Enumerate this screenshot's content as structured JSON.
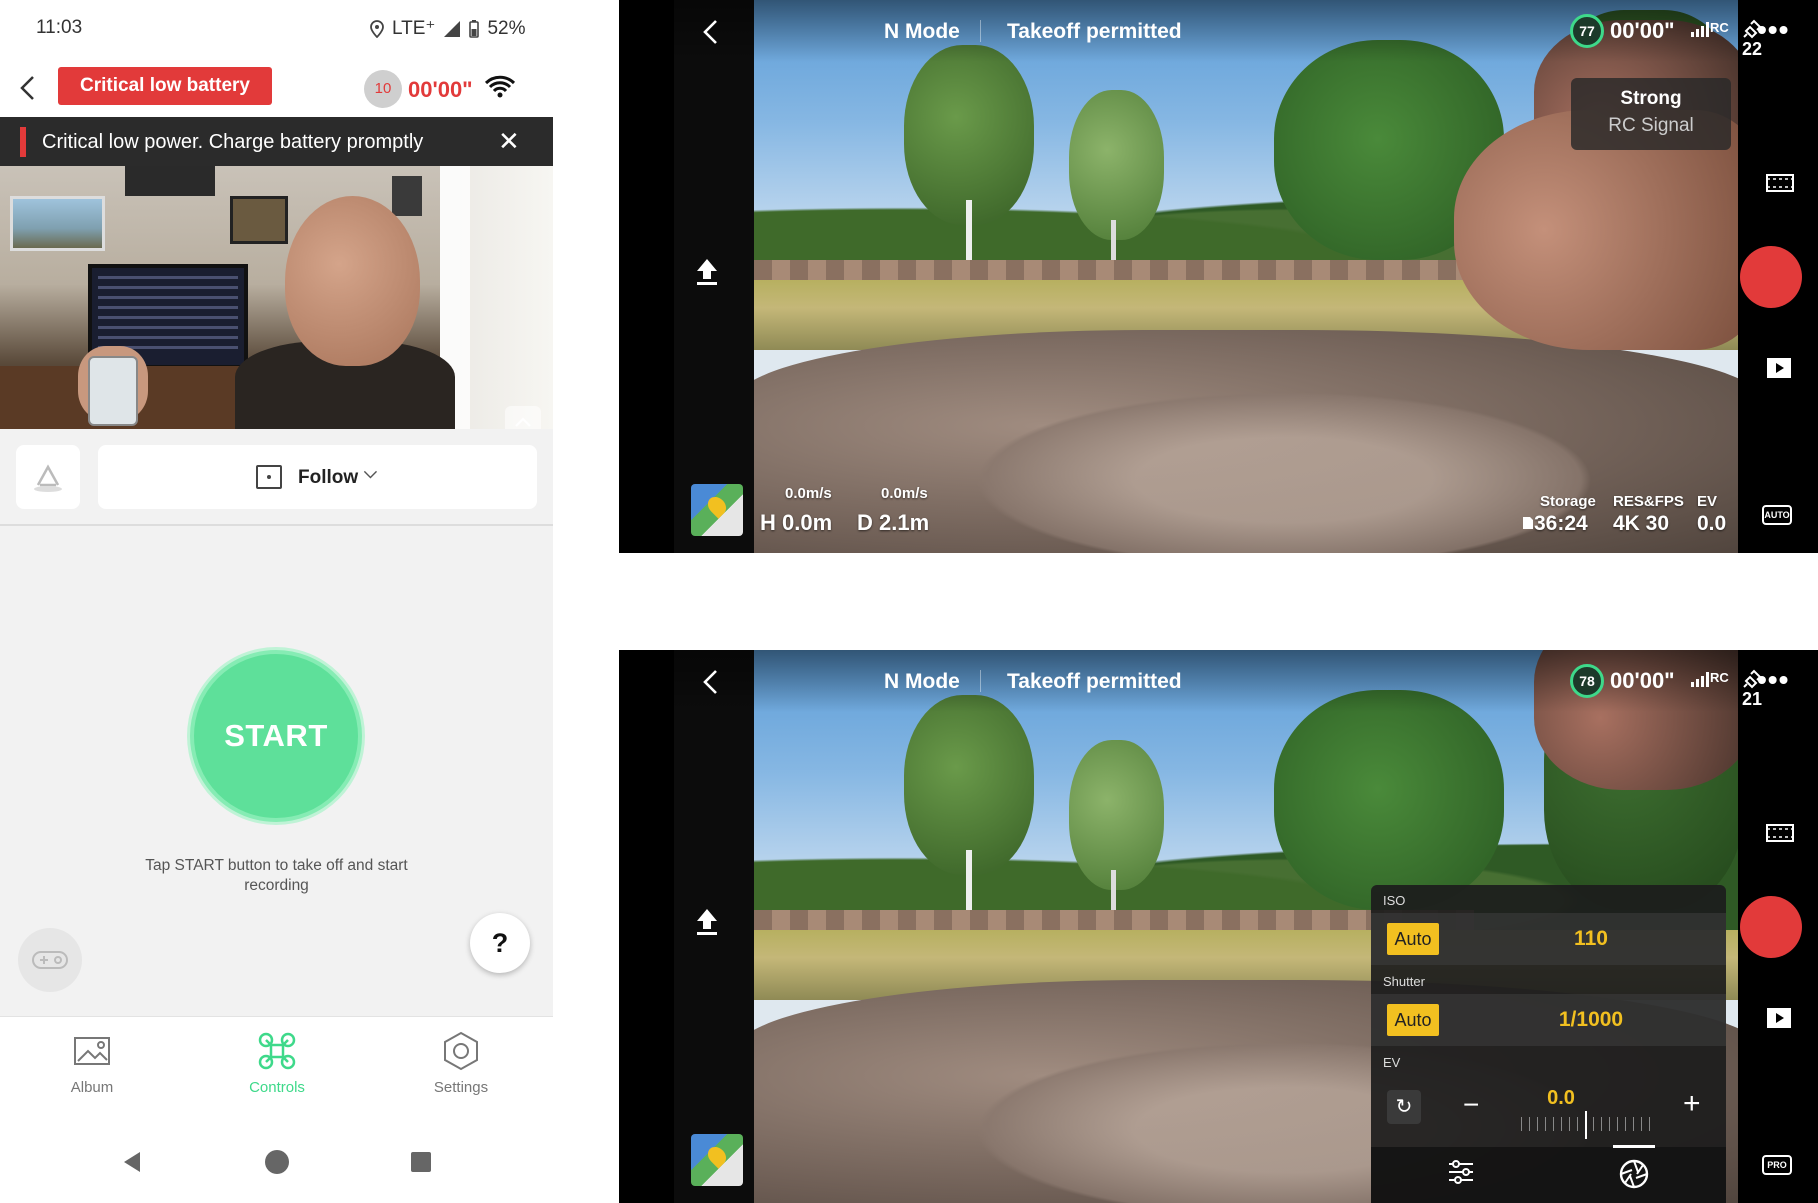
{
  "phone": {
    "status": {
      "time": "11:03",
      "network": "LTE⁺",
      "battery": "52%"
    },
    "header": {
      "alert": "Critical low battery",
      "rth_value": "10",
      "rth_time": "00'00\""
    },
    "banner": {
      "message": "Critical low power. Charge battery promptly",
      "close": "✕"
    },
    "mode_selector": {
      "label": "Follow",
      "chevron": "⌵"
    },
    "start_button": "START",
    "hint": "Tap START button to take off and start recording",
    "help": "?",
    "tabs": [
      {
        "label": "Album",
        "icon": "album-icon"
      },
      {
        "label": "Controls",
        "icon": "drone-icon",
        "active": true
      },
      {
        "label": "Settings",
        "icon": "settings-icon"
      }
    ],
    "accent": "#3ed98a",
    "alert_color": "#e23a3a"
  },
  "drone_view_a": {
    "mode": "N Mode",
    "status": "Takeoff permitted",
    "battery": "77",
    "flight_time": "00'00\"",
    "rc": "RC",
    "satellites": "22",
    "more": "•••",
    "tooltip": {
      "title": "Strong",
      "subtitle": "RC Signal"
    },
    "telemetry": {
      "vspeed": "0.0m/s",
      "hspeed": "0.0m/s",
      "h_label": "H",
      "h_value": "0.0m",
      "d_label": "D",
      "d_value": "2.1m"
    },
    "info": {
      "storage_label": "Storage",
      "storage_value": "36:24",
      "res_label": "RES&FPS",
      "res_value": "4K 30",
      "ev_label": "EV",
      "ev_value": "0.0"
    },
    "camera_mode": "AUTO"
  },
  "drone_view_b": {
    "mode": "N Mode",
    "status": "Takeoff permitted",
    "battery": "78",
    "flight_time": "00'00\"",
    "rc": "RC",
    "satellites": "21",
    "more": "•••",
    "camera_panel": {
      "iso_label": "ISO",
      "iso_mode": "Auto",
      "iso_value": "110",
      "shutter_label": "Shutter",
      "shutter_mode": "Auto",
      "shutter_value": "1/1000",
      "ev_label": "EV",
      "ev_value": "0.0",
      "minus": "−",
      "plus": "+"
    },
    "camera_mode": "PRO"
  }
}
